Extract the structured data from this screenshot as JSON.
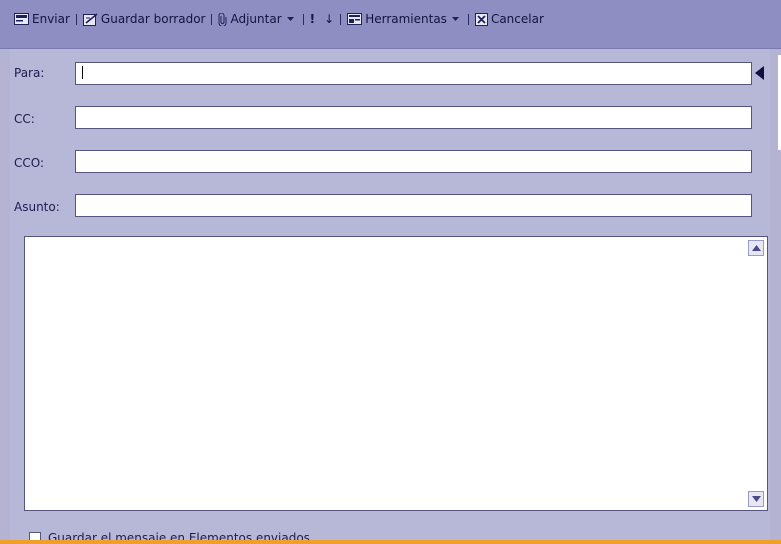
{
  "toolbar": {
    "send_label": "Enviar",
    "save_draft_label": "Guardar borrador",
    "attach_label": "Adjuntar",
    "importance_label": "!",
    "low_importance_label": "↓",
    "tools_label": "Herramientas",
    "cancel_label": "Cancelar"
  },
  "form": {
    "to_label": "Para:",
    "to_value": "",
    "cc_label": "CC:",
    "cc_value": "",
    "bcc_label": "CCO:",
    "bcc_value": "",
    "subject_label": "Asunto:",
    "subject_value": "",
    "body_value": ""
  },
  "footer": {
    "checkbox_label": "Guardar el mensaje en Elementos enviados"
  },
  "colors": {
    "toolbar_bg": "#8e8ec2",
    "panel_bg": "#b7b7d8",
    "accent_stripe": "#f0a02a"
  }
}
